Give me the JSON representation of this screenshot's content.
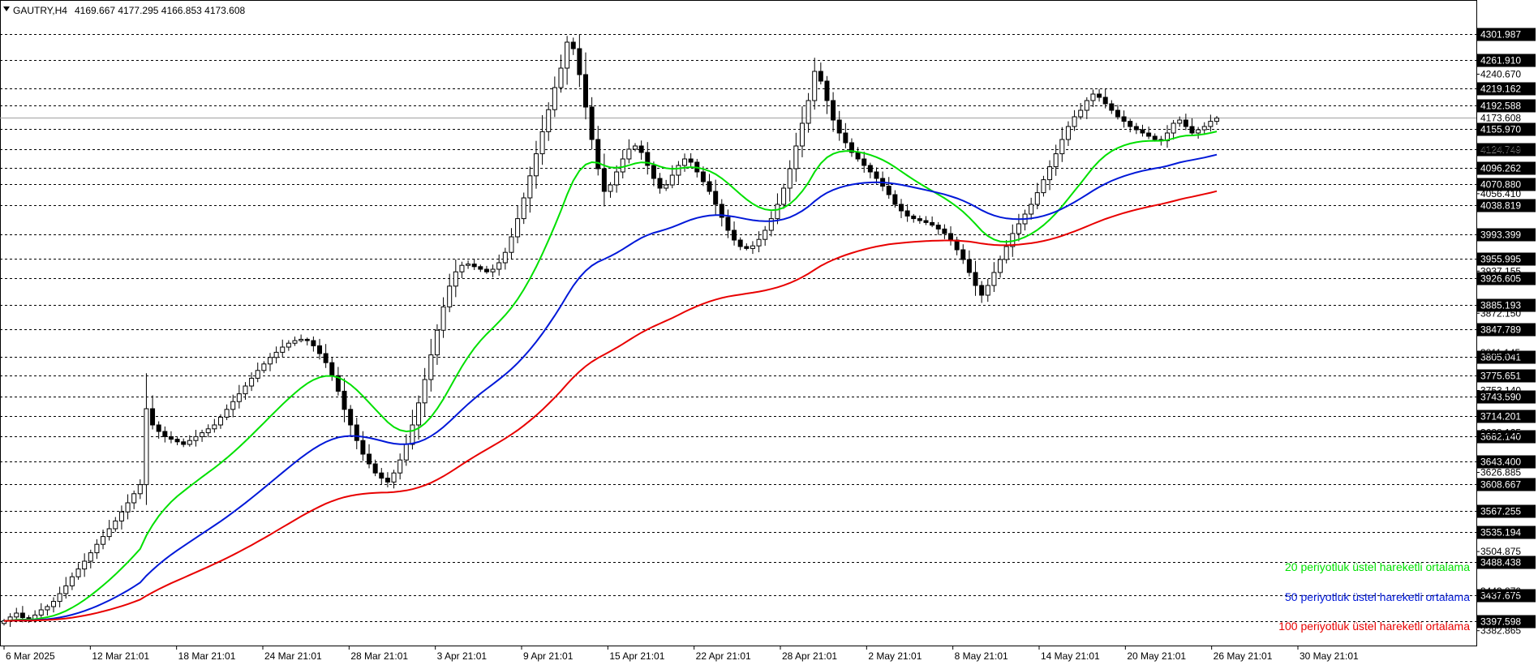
{
  "window": {
    "symbol": "GAUTRY,H4",
    "ohlc": "4169.667 4177.295 4166.853 4173.608",
    "collapse_icon": "triangle-down-icon"
  },
  "chart_data": {
    "type": "line",
    "x_labels": [
      "6 Mar 2025",
      "12 Mar 21:01",
      "18 Mar 21:01",
      "24 Mar 21:01",
      "28 Mar 21:01",
      "3 Apr 21:01",
      "9 Apr 21:01",
      "15 Apr 21:01",
      "22 Apr 21:01",
      "28 Apr 21:01",
      "2 May 21:01",
      "8 May 21:01",
      "14 May 21:01",
      "20 May 21:01",
      "26 May 21:01",
      "30 May 21:01"
    ],
    "ylim": [
      3360,
      4355
    ],
    "current_price": "4173.608",
    "levels": [
      "4301.987",
      "4261.910",
      "4219.162",
      "4192.588",
      "4155.970",
      "4124.749",
      "4096.262",
      "4070.880",
      "4038.819",
      "3993.399",
      "3955.995",
      "3926.605",
      "3885.193",
      "3847.789",
      "3805.041",
      "3775.651",
      "3743.590",
      "3714.201",
      "3682.140",
      "3643.400",
      "3608.667",
      "3567.255",
      "3535.194",
      "3488.438",
      "3437.675",
      "3397.598"
    ],
    "ticks": [
      "4240.670",
      "4124.749",
      "4056.410",
      "3937.155",
      "3872.150",
      "3811.145",
      "3753.140",
      "3688.125",
      "3626.885",
      "3504.875",
      "3443.870",
      "3382.865"
    ],
    "price_closes": [
      3398,
      3404,
      3410,
      3403,
      3400,
      3407,
      3415,
      3420,
      3428,
      3440,
      3452,
      3466,
      3478,
      3490,
      3503,
      3516,
      3528,
      3540,
      3552,
      3566,
      3580,
      3594,
      3608,
      3725,
      3700,
      3690,
      3682,
      3678,
      3674,
      3670,
      3676,
      3682,
      3688,
      3694,
      3700,
      3712,
      3724,
      3736,
      3748,
      3760,
      3772,
      3784,
      3794,
      3804,
      3812,
      3820,
      3826,
      3830,
      3832,
      3830,
      3822,
      3810,
      3796,
      3776,
      3752,
      3724,
      3700,
      3676,
      3655,
      3640,
      3626,
      3618,
      3612,
      3626,
      3646,
      3670,
      3700,
      3734,
      3770,
      3808,
      3846,
      3882,
      3914,
      3936,
      3946,
      3948,
      3944,
      3940,
      3936,
      3940,
      3950,
      3966,
      3990,
      4018,
      4050,
      4084,
      4118,
      4152,
      4186,
      4220,
      4250,
      4290,
      4280,
      4240,
      4190,
      4140,
      4095,
      4060,
      4070,
      4090,
      4110,
      4125,
      4130,
      4120,
      4100,
      4080,
      4065,
      4070,
      4085,
      4100,
      4110,
      4105,
      4090,
      4075,
      4060,
      4040,
      4020,
      4000,
      3985,
      3975,
      3972,
      3976,
      3986,
      4000,
      4018,
      4040,
      4065,
      4095,
      4130,
      4165,
      4200,
      4245,
      4230,
      4200,
      4170,
      4150,
      4135,
      4120,
      4110,
      4100,
      4090,
      4080,
      4068,
      4055,
      4040,
      4030,
      4022,
      4018,
      4015,
      4012,
      4008,
      4002,
      3995,
      3985,
      3970,
      3955,
      3935,
      3915,
      3900,
      3915,
      3935,
      3955,
      3975,
      3995,
      4010,
      4025,
      4040,
      4058,
      4078,
      4098,
      4118,
      4140,
      4160,
      4175,
      4185,
      4200,
      4210,
      4205,
      4195,
      4185,
      4175,
      4168,
      4160,
      4155,
      4150,
      4145,
      4140,
      4138,
      4150,
      4165,
      4170,
      4160,
      4150,
      4155,
      4160,
      4168,
      4173
    ],
    "series": [
      {
        "name": "20 periyotluk üstel hareketli ortalama",
        "color": "#00e000"
      },
      {
        "name": "50 periyotluk üstel hareketli ortalama",
        "color": "#0018d8"
      },
      {
        "name": "100 periyotluk üstel hareketli ortalama",
        "color": "#e80000"
      }
    ],
    "ema_periods": [
      20,
      50,
      100
    ],
    "grid": true,
    "legend_position": "bottom-right",
    "candle_color": "#000000"
  }
}
